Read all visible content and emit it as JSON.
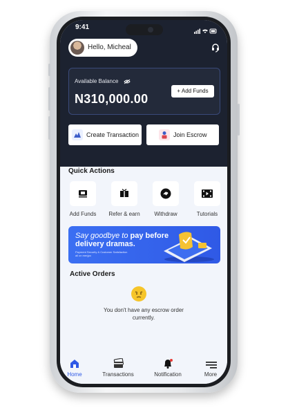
{
  "status": {
    "time": "9:41"
  },
  "header": {
    "greeting": "Hello, Micheal"
  },
  "balance": {
    "label": "Available Balance",
    "amount": "N310,000.00",
    "add_funds": "+ Add Funds"
  },
  "actions": {
    "create": "Create Transaction",
    "join": "Join Escrow"
  },
  "quick_actions": {
    "title": "Quick Actions",
    "items": [
      {
        "label": "Add Funds",
        "icon": "wallet-icon"
      },
      {
        "label": "Refer & earn",
        "icon": "gift-icon"
      },
      {
        "label": "Withdraw",
        "icon": "withdraw-icon"
      },
      {
        "label": "Tutorials",
        "icon": "film-icon"
      }
    ]
  },
  "banner": {
    "line1_prefix": "Say goodbye to ",
    "line1_bold": "pay before",
    "line2": "delivery dramas.",
    "small": "Payment Security & Customer Satisfaction all on merjpo"
  },
  "orders": {
    "title": "Active Orders",
    "empty_text": "You don't have any escrow order currently."
  },
  "nav": [
    {
      "label": "Home",
      "icon": "home-icon",
      "active": true
    },
    {
      "label": "Transactions",
      "icon": "card-icon",
      "active": false
    },
    {
      "label": "Notification",
      "icon": "bell-icon",
      "active": false
    },
    {
      "label": "More",
      "icon": "menu-icon",
      "active": false
    }
  ],
  "colors": {
    "accent": "#2f59e6",
    "dark": "#1c2230"
  }
}
